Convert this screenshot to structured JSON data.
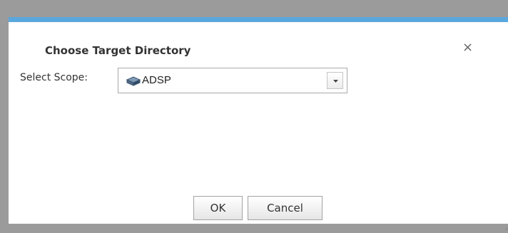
{
  "dialog": {
    "title": "Choose Target Directory",
    "close_glyph": "×",
    "scope_label": "Select Scope:",
    "scope_value": "ADSP",
    "scope_icon": "directory-scope-icon",
    "ok_label": "OK",
    "cancel_label": "Cancel",
    "accent_color": "#5aa7dd"
  }
}
